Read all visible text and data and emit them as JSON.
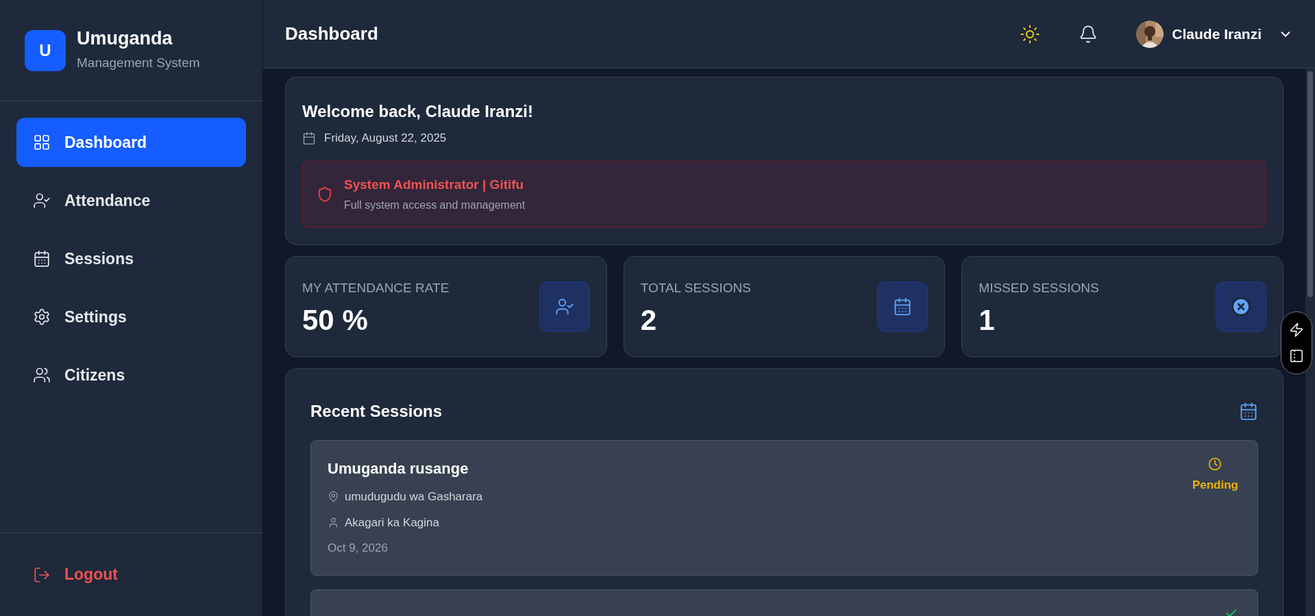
{
  "sidebar": {
    "logo_letter": "U",
    "title": "Umuganda",
    "subtitle": "Management System",
    "items": [
      {
        "label": "Dashboard",
        "selected": true
      },
      {
        "label": "Attendance",
        "selected": false
      },
      {
        "label": "Sessions",
        "selected": false
      },
      {
        "label": "Settings",
        "selected": false
      },
      {
        "label": "Citizens",
        "selected": false
      }
    ],
    "logout": "Logout"
  },
  "header": {
    "title": "Dashboard",
    "user": {
      "name": "Claude Iranzi"
    }
  },
  "welcome": {
    "title": "Welcome back, Claude Iranzi!",
    "date": "Friday, August 22, 2025",
    "role": {
      "title": "System Administrator | Gitifu",
      "description": "Full system access and management"
    }
  },
  "stats": [
    {
      "label": "MY ATTENDANCE RATE",
      "value": "50 %"
    },
    {
      "label": "TOTAL SESSIONS",
      "value": "2"
    },
    {
      "label": "MISSED SESSIONS",
      "value": "1"
    }
  ],
  "recent_sessions": {
    "title": "Recent Sessions",
    "sessions": [
      {
        "title": "Umuganda rusange",
        "location": "umudugudu wa Gasharara",
        "cell": "Akagari ka Kagina",
        "date": "Oct 9, 2026",
        "status": {
          "kind": "pending",
          "label": "Pending"
        }
      },
      {
        "status": {
          "kind": "completed"
        }
      }
    ]
  }
}
